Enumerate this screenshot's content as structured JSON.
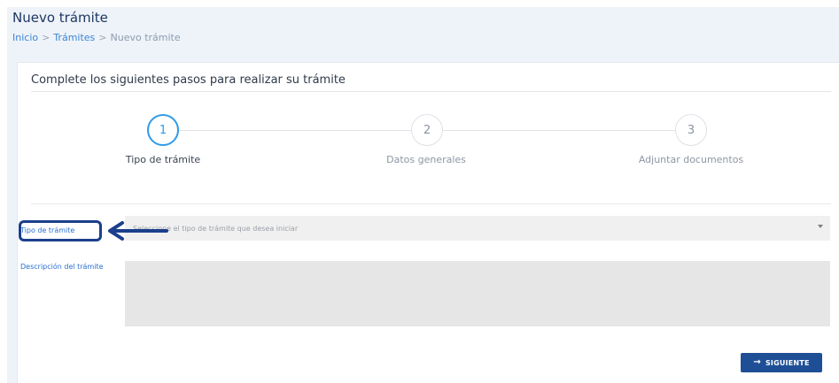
{
  "page": {
    "title": "Nuevo trámite",
    "breadcrumb": {
      "home": "Inicio",
      "sep1": ">",
      "section": "Trámites",
      "sep2": ">",
      "current": "Nuevo trámite"
    }
  },
  "wizard": {
    "heading": "Complete los siguientes pasos para realizar su trámite",
    "steps": [
      {
        "number": "1",
        "label": "Tipo de trámite",
        "active": true
      },
      {
        "number": "2",
        "label": "Datos generales",
        "active": false
      },
      {
        "number": "3",
        "label": "Adjuntar documentos",
        "active": false
      }
    ]
  },
  "form": {
    "tipo": {
      "label": "Tipo de trámite",
      "placeholder": "Seleccione el tipo de trámite que desea iniciar"
    },
    "descripcion": {
      "label": "Descripción del trámite",
      "value": ""
    },
    "next_button": {
      "icon": "→",
      "label": "SIGUIENTE"
    }
  },
  "annotation": {
    "highlight_color": "#1b3f8c"
  },
  "colors": {
    "accent": "#2f9be8",
    "link": "#3a84d6",
    "button": "#1e4f96"
  }
}
